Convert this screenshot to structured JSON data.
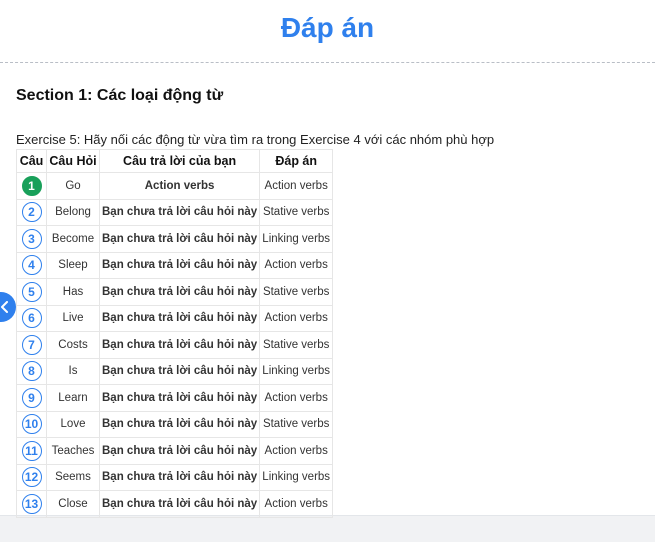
{
  "page": {
    "title": "Đáp án"
  },
  "section": {
    "title": "Section 1: Các loại động từ"
  },
  "exercise": {
    "instruction": "Exercise 5: Hãy nối các động từ vừa tìm ra trong Exercise 4 với các nhóm phù hợp"
  },
  "table": {
    "headers": {
      "num": "Câu",
      "question": "Câu Hỏi",
      "your_answer": "Câu trả lời của bạn",
      "answer_key": "Đáp án"
    },
    "rows": [
      {
        "num": "1",
        "question": "Go",
        "your_answer": "Action verbs",
        "answer_key": "Action verbs",
        "status": "correct"
      },
      {
        "num": "2",
        "question": "Belong",
        "your_answer": "Bạn chưa trả lời câu hỏi này",
        "answer_key": "Stative verbs",
        "status": "unanswered"
      },
      {
        "num": "3",
        "question": "Become",
        "your_answer": "Bạn chưa trả lời câu hỏi này",
        "answer_key": "Linking verbs",
        "status": "unanswered"
      },
      {
        "num": "4",
        "question": "Sleep",
        "your_answer": "Bạn chưa trả lời câu hỏi này",
        "answer_key": "Action verbs",
        "status": "unanswered"
      },
      {
        "num": "5",
        "question": "Has",
        "your_answer": "Bạn chưa trả lời câu hỏi này",
        "answer_key": "Stative verbs",
        "status": "unanswered"
      },
      {
        "num": "6",
        "question": "Live",
        "your_answer": "Bạn chưa trả lời câu hỏi này",
        "answer_key": "Action verbs",
        "status": "unanswered"
      },
      {
        "num": "7",
        "question": "Costs",
        "your_answer": "Bạn chưa trả lời câu hỏi này",
        "answer_key": "Stative verbs",
        "status": "unanswered"
      },
      {
        "num": "8",
        "question": "Is",
        "your_answer": "Bạn chưa trả lời câu hỏi này",
        "answer_key": "Linking verbs",
        "status": "unanswered"
      },
      {
        "num": "9",
        "question": "Learn",
        "your_answer": "Bạn chưa trả lời câu hỏi này",
        "answer_key": "Action verbs",
        "status": "unanswered"
      },
      {
        "num": "10",
        "question": "Love",
        "your_answer": "Bạn chưa trả lời câu hỏi này",
        "answer_key": "Stative verbs",
        "status": "unanswered"
      },
      {
        "num": "11",
        "question": "Teaches",
        "your_answer": "Bạn chưa trả lời câu hỏi này",
        "answer_key": "Action verbs",
        "status": "unanswered"
      },
      {
        "num": "12",
        "question": "Seems",
        "your_answer": "Bạn chưa trả lời câu hỏi này",
        "answer_key": "Linking verbs",
        "status": "unanswered"
      },
      {
        "num": "13",
        "question": "Close",
        "your_answer": "Bạn chưa trả lời câu hỏi này",
        "answer_key": "Action verbs",
        "status": "unanswered"
      }
    ]
  },
  "side_tab": {
    "icon": "chevron-left-icon"
  },
  "colors": {
    "accent": "#2f80ed",
    "correct": "#19a05a",
    "unanswered": "#e03b3b"
  }
}
